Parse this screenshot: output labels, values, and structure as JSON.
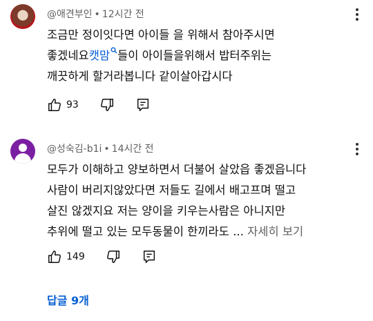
{
  "comments": [
    {
      "author": "@애견부인",
      "time": "12시간 전",
      "lines": [
        "조금만 정이잇다면 아이들 을 위해서 참아주시면",
        "좋겠네요",
        "깨끗하게 할거라봅니다 같이살아갑시다"
      ],
      "mention": "캣맘",
      "line2_after": "들이 아이들을위해서 밥터주위는",
      "likes": "93"
    },
    {
      "author": "@성숙김-b1i",
      "time": "14시간 전",
      "lines": [
        "모두가 이해하고 양보하면서 더불어 살았읍 좋겠읍니다",
        "사람이 버리지않았다면  저들도 길에서 배고프며 떨고",
        "살진 않겠지요  저는 양이을 키우는사람은 아니지만",
        "추위에 떨고 있는 모두동물이 한끼라도 ..."
      ],
      "read_more": "자세히 보기",
      "likes": "149"
    }
  ],
  "replies_label": "답글 9개",
  "icons": [
    "like-icon",
    "dislike-icon",
    "reply-icon",
    "more-vert-icon",
    "search-mention-icon"
  ],
  "colors": {
    "link": "#065fd4",
    "meta": "#606060",
    "text": "#0f0f0f"
  }
}
